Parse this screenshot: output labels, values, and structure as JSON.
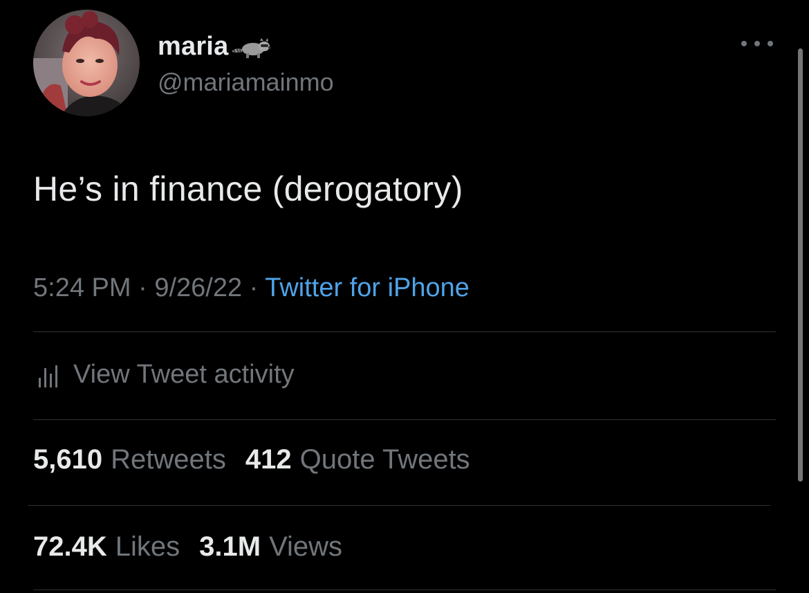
{
  "author": {
    "display_name": "maria",
    "handle": "@mariamainmo",
    "name_emoji_icon": "raccoon-icon"
  },
  "tweet": {
    "text": "He’s in finance (derogatory)",
    "time": "5:24 PM",
    "date": "9/26/22",
    "separator": "·",
    "source": "Twitter for iPhone"
  },
  "activity": {
    "label": "View Tweet activity",
    "icon": "bar-chart-icon"
  },
  "stats": {
    "retweets_count": "5,610",
    "retweets_label": "Retweets",
    "quotes_count": "412",
    "quotes_label": "Quote Tweets",
    "likes_count": "72.4K",
    "likes_label": "Likes",
    "views_count": "3.1M",
    "views_label": "Views"
  },
  "colors": {
    "background": "#000000",
    "primary_text": "#e7e9ea",
    "secondary_text": "#71767b",
    "link": "#4fa3e8",
    "divider": "#2f3336"
  }
}
